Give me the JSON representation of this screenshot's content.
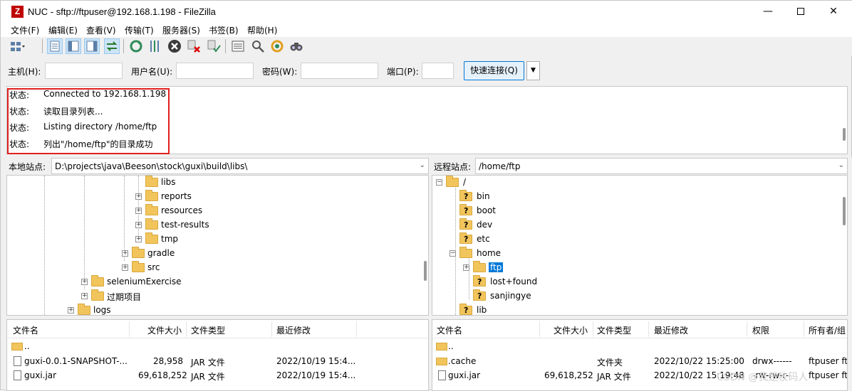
{
  "window": {
    "title": "NUC - sftp://ftpuser@192.168.1.198 - FileZilla",
    "app_icon": "Z",
    "controls": {
      "minimize": "—",
      "close": "✕"
    }
  },
  "menu": [
    "文件(F)",
    "编辑(E)",
    "查看(V)",
    "传输(T)",
    "服务器(S)",
    "书签(B)",
    "帮助(H)"
  ],
  "toolbar": {
    "icons": [
      "site-manager-icon",
      "toggle-log-icon",
      "toggle-local-tree-icon",
      "toggle-remote-tree-icon",
      "toggle-queue-icon",
      "refresh-icon",
      "process-queue-icon",
      "cancel-icon",
      "disconnect-icon",
      "reconnect-icon",
      "filter-icon",
      "compare-icon",
      "sync-browse-icon",
      "find-icon"
    ]
  },
  "quickconnect": {
    "host_label": "主机(H):",
    "user_label": "用户名(U):",
    "pass_label": "密码(W):",
    "port_label": "端口(P):",
    "connect_button": "快速连接(Q)",
    "dropdown": "▼"
  },
  "log": {
    "entries": [
      {
        "tag": "状态:",
        "message": "Connected to 192.168.1.198"
      },
      {
        "tag": "状态:",
        "message": "读取目录列表..."
      },
      {
        "tag": "状态:",
        "message": "Listing directory /home/ftp"
      },
      {
        "tag": "状态:",
        "message": "列出\"/home/ftp\"的目录成功"
      }
    ]
  },
  "local": {
    "site_label": "本地站点:",
    "path": "D:\\projects\\java\\Beeson\\stock\\guxi\\build\\libs\\",
    "tree": [
      {
        "label": "libs"
      },
      {
        "label": "reports"
      },
      {
        "label": "resources"
      },
      {
        "label": "test-results"
      },
      {
        "label": "tmp"
      },
      {
        "label": "gradle"
      },
      {
        "label": "src"
      },
      {
        "label": "seleniumExercise"
      },
      {
        "label": "过期项目"
      },
      {
        "label": "logs"
      }
    ],
    "columns": {
      "name": "文件名",
      "size": "文件大小",
      "type": "文件类型",
      "modified": "最近修改"
    },
    "files": [
      {
        "name": "..",
        "size": "",
        "type": "",
        "modified": ""
      },
      {
        "name": "guxi-0.0.1-SNAPSHOT-...",
        "size": "28,958",
        "type": "JAR 文件",
        "modified": "2022/10/19 15:4..."
      },
      {
        "name": "guxi.jar",
        "size": "69,618,252",
        "type": "JAR 文件",
        "modified": "2022/10/19 15:4..."
      }
    ]
  },
  "remote": {
    "site_label": "远程站点:",
    "path": "/home/ftp",
    "tree": [
      {
        "label": "/"
      },
      {
        "label": "bin"
      },
      {
        "label": "boot"
      },
      {
        "label": "dev"
      },
      {
        "label": "etc"
      },
      {
        "label": "home"
      },
      {
        "label": "ftp"
      },
      {
        "label": "lost+found"
      },
      {
        "label": "sanjingye"
      },
      {
        "label": "lib"
      }
    ],
    "columns": {
      "name": "文件名",
      "size": "文件大小",
      "type": "文件类型",
      "modified": "最近修改",
      "perms": "权限",
      "owner": "所有者/组"
    },
    "files": [
      {
        "name": "..",
        "size": "",
        "type": "",
        "modified": "",
        "perms": "",
        "owner": ""
      },
      {
        "name": ".cache",
        "size": "",
        "type": "文件夹",
        "modified": "2022/10/22 15:25:00",
        "perms": "drwx------",
        "owner": "ftpuser ftp"
      },
      {
        "name": "guxi.jar",
        "size": "69,618,252",
        "type": "JAR 文件",
        "modified": "2022/10/22 15:19:48",
        "perms": "-rw-rw-r--",
        "owner": "ftpuser ftp"
      }
    ]
  },
  "watermark": "CSDN @我是牧码人"
}
